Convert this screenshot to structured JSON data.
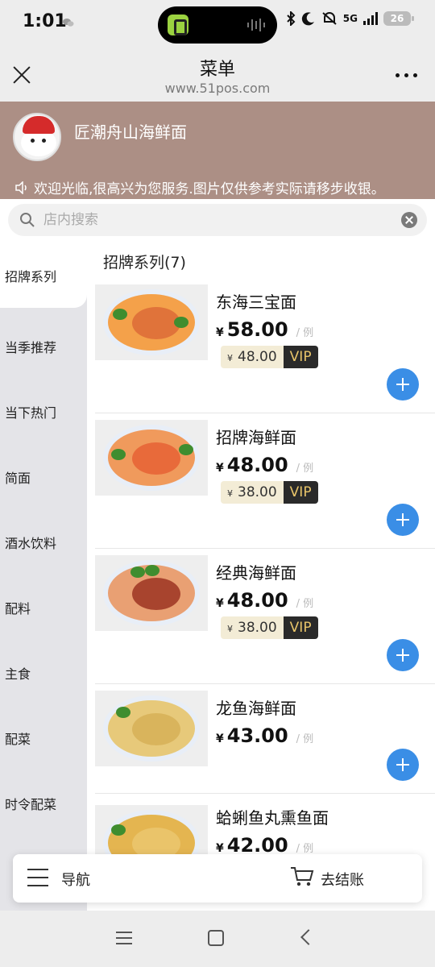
{
  "status_bar": {
    "time": "1:01",
    "network": "5G",
    "battery": "26"
  },
  "title_bar": {
    "title": "菜单",
    "url": "www.51pos.com"
  },
  "store": {
    "name": "匠潮舟山海鲜面",
    "notice": "欢迎光临,很高兴为您服务.图片仅供参考实际请移步收银。"
  },
  "search": {
    "placeholder": "店内搜索"
  },
  "sidebar": {
    "categories": [
      {
        "label": "招牌系列"
      },
      {
        "label": "当季推荐"
      },
      {
        "label": "当下热门"
      },
      {
        "label": "简面"
      },
      {
        "label": "酒水饮料"
      },
      {
        "label": "配料"
      },
      {
        "label": "主食"
      },
      {
        "label": "配菜"
      },
      {
        "label": "时令配菜"
      }
    ]
  },
  "menu": {
    "section_title": "招牌系列(7)",
    "items": [
      {
        "name": "东海三宝面",
        "yen": "¥",
        "price": "58.00",
        "unit": "/ 例",
        "vip_yen": "¥",
        "vip_price": "48.00",
        "vip_label": "VIP"
      },
      {
        "name": "招牌海鲜面",
        "yen": "¥",
        "price": "48.00",
        "unit": "/ 例",
        "vip_yen": "¥",
        "vip_price": "38.00",
        "vip_label": "VIP"
      },
      {
        "name": "经典海鲜面",
        "yen": "¥",
        "price": "48.00",
        "unit": "/ 例",
        "vip_yen": "¥",
        "vip_price": "38.00",
        "vip_label": "VIP"
      },
      {
        "name": "龙鱼海鲜面",
        "yen": "¥",
        "price": "43.00",
        "unit": "/ 例"
      },
      {
        "name": "蛤蜊鱼丸熏鱼面",
        "yen": "¥",
        "price": "42.00",
        "unit": "/ 例"
      }
    ]
  },
  "bottom_bar": {
    "nav_label": "导航",
    "checkout_label": "去结账"
  },
  "colors": {
    "accent": "#3a8ee6",
    "header_bg": "#ac8f85",
    "vip_bg": "#f3ecd6",
    "vip_tag_bg": "#2a2a2a",
    "vip_tag_text": "#e9c56a"
  }
}
